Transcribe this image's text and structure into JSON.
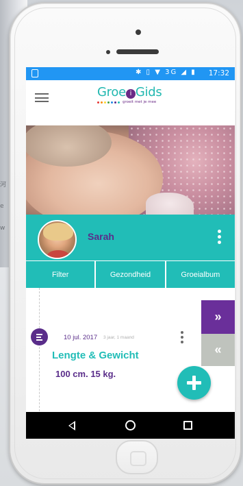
{
  "background": {
    "fragments": [
      "河",
      "e",
      "w"
    ]
  },
  "statusbar": {
    "network": "3G",
    "time": "17:32"
  },
  "appbar": {
    "menu_icon": "hamburger-icon",
    "logo": {
      "name_part1": "Groe",
      "name_i": "i",
      "name_part2": "Gids",
      "tagline": "groeit met je mee",
      "dot_colors": [
        "#e53935",
        "#fb8c00",
        "#fdd835",
        "#43a047",
        "#1e88e5",
        "#5a2d8a",
        "#21bdb7"
      ]
    }
  },
  "profile": {
    "child_name": "Sarah",
    "menu_icon": "more-vertical-icon"
  },
  "tabs": [
    {
      "label": "Filter"
    },
    {
      "label": "Gezondheid"
    },
    {
      "label": "Groeialbum"
    }
  ],
  "entry": {
    "date": "10 jul. 2017",
    "age": "3 jaar, 1 maand",
    "title": "Lengte & Gewicht",
    "values": "100 cm.  15 kg."
  },
  "pager": {
    "forward": "»",
    "back": "«"
  },
  "colors": {
    "teal": "#21bdb7",
    "purple": "#5a2d8a",
    "statusbar_blue": "#2196f3"
  }
}
